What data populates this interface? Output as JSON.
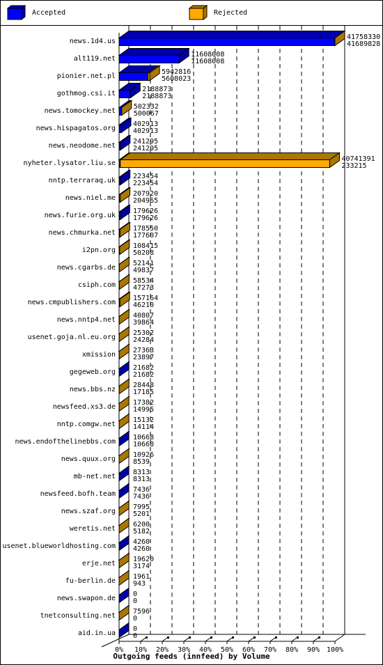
{
  "legend": {
    "accepted_label": "Accepted",
    "rejected_label": "Rejected"
  },
  "colors": {
    "accepted": "#0000ff",
    "accepted_dark": "#0000aa",
    "rejected": "#ffaa00",
    "rejected_dark": "#aa7700"
  },
  "chart_data": {
    "type": "bar",
    "orientation": "horizontal",
    "stacked": true,
    "style": "3d",
    "title": "",
    "xlabel": "Outgoing feeds (innfeed) by Volume",
    "ylabel": "",
    "xlim": [
      0,
      100
    ],
    "x_unit": "percent of max offered",
    "grid": true,
    "legend_position": "top",
    "x_ticks": [
      "0%",
      "10%",
      "20%",
      "30%",
      "40%",
      "50%",
      "60%",
      "70%",
      "80%",
      "90%",
      "100%"
    ],
    "series": [
      {
        "name": "Accepted"
      },
      {
        "name": "Rejected"
      }
    ],
    "rows": [
      {
        "label": "news.1d4.us",
        "offered": 41758330,
        "accepted": 41689828
      },
      {
        "label": "alt119.net",
        "offered": 11608008,
        "accepted": 11608008
      },
      {
        "label": "pionier.net.pl",
        "offered": 5942816,
        "accepted": 5608023
      },
      {
        "label": "gothmog.csi.it",
        "offered": 2188873,
        "accepted": 2188873
      },
      {
        "label": "news.tomockey.net",
        "offered": 502332,
        "accepted": 500067
      },
      {
        "label": "news.hispagatos.org",
        "offered": 402913,
        "accepted": 402913
      },
      {
        "label": "news.neodome.net",
        "offered": 241295,
        "accepted": 241295
      },
      {
        "label": "nyheter.lysator.liu.se",
        "offered": 40741391,
        "accepted": 233215
      },
      {
        "label": "nntp.terraraq.uk",
        "offered": 223454,
        "accepted": 223454
      },
      {
        "label": "news.niel.me",
        "offered": 207920,
        "accepted": 204965
      },
      {
        "label": "news.furie.org.uk",
        "offered": 179626,
        "accepted": 179626
      },
      {
        "label": "news.chmurka.net",
        "offered": 178550,
        "accepted": 177607
      },
      {
        "label": "i2pn.org",
        "offered": 108415,
        "accepted": 50208
      },
      {
        "label": "news.cgarbs.de",
        "offered": 52141,
        "accepted": 49837
      },
      {
        "label": "csiph.com",
        "offered": 58534,
        "accepted": 47273
      },
      {
        "label": "news.cmpublishers.com",
        "offered": 157164,
        "accepted": 46210
      },
      {
        "label": "news.nntp4.net",
        "offered": 40807,
        "accepted": 39864
      },
      {
        "label": "usenet.goja.nl.eu.org",
        "offered": 25302,
        "accepted": 24284
      },
      {
        "label": "xmission",
        "offered": 27363,
        "accepted": 23897
      },
      {
        "label": "gegeweb.org",
        "offered": 21682,
        "accepted": 21682
      },
      {
        "label": "news.bbs.nz",
        "offered": 28448,
        "accepted": 17185
      },
      {
        "label": "newsfeed.xs3.de",
        "offered": 17382,
        "accepted": 14995
      },
      {
        "label": "nntp.comgw.net",
        "offered": 15132,
        "accepted": 14114
      },
      {
        "label": "news.endofthelinebbs.com",
        "offered": 10668,
        "accepted": 10668
      },
      {
        "label": "news.quux.org",
        "offered": 10926,
        "accepted": 8539
      },
      {
        "label": "mb-net.net",
        "offered": 8313,
        "accepted": 8313
      },
      {
        "label": "newsfeed.bofh.team",
        "offered": 7436,
        "accepted": 7436
      },
      {
        "label": "news.szaf.org",
        "offered": 7995,
        "accepted": 5201
      },
      {
        "label": "weretis.net",
        "offered": 6200,
        "accepted": 5182
      },
      {
        "label": "usenet.blueworldhosting.com",
        "offered": 4260,
        "accepted": 4260
      },
      {
        "label": "erje.net",
        "offered": 19620,
        "accepted": 3174
      },
      {
        "label": "fu-berlin.de",
        "offered": 1961,
        "accepted": 943
      },
      {
        "label": "news.swapon.de",
        "offered": 0,
        "accepted": 0
      },
      {
        "label": "tnetconsulting.net",
        "offered": 7596,
        "accepted": 0
      },
      {
        "label": "aid.in.ua",
        "offered": 0,
        "accepted": 0
      }
    ]
  }
}
